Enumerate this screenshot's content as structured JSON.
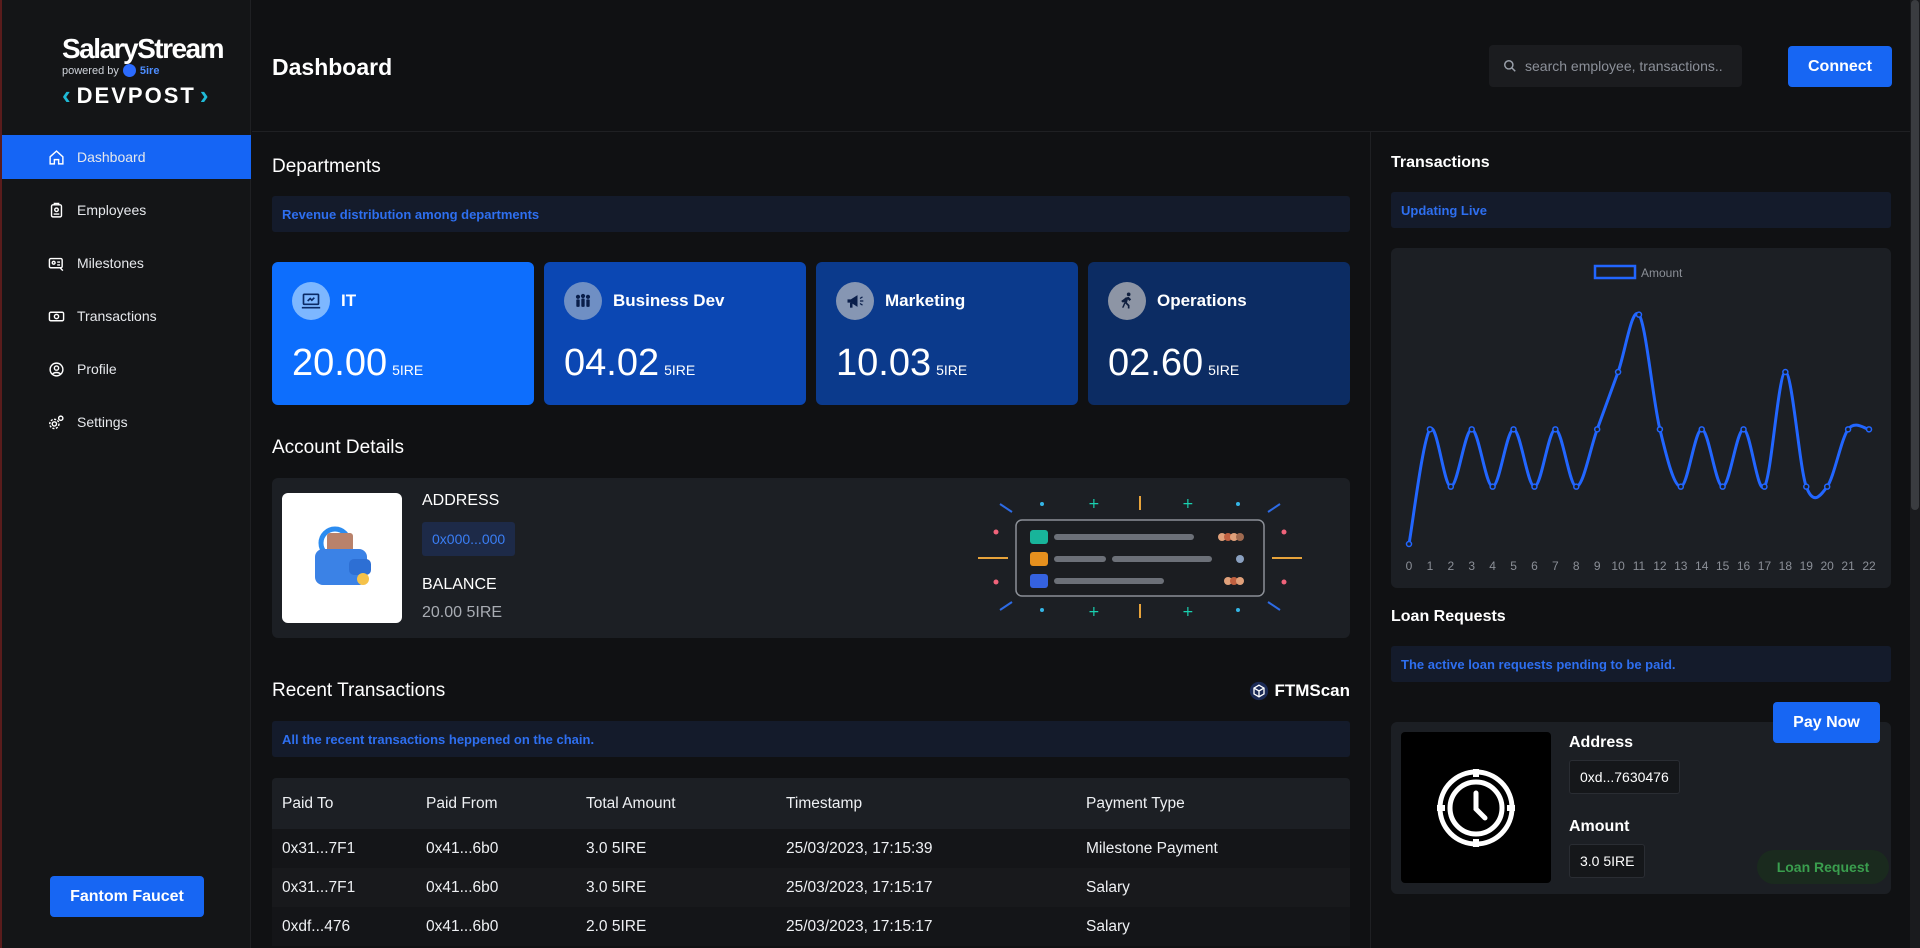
{
  "brand": {
    "title": "SalaryStream",
    "powered": "powered by",
    "powered_brand": "5ire",
    "devpost": "DEVPOST"
  },
  "sidebar": {
    "items": [
      {
        "label": "Dashboard",
        "icon": "home-icon",
        "active": true
      },
      {
        "label": "Employees",
        "icon": "badge-icon"
      },
      {
        "label": "Milestones",
        "icon": "card-icon"
      },
      {
        "label": "Transactions",
        "icon": "money-icon"
      },
      {
        "label": "Profile",
        "icon": "user-icon"
      },
      {
        "label": "Settings",
        "icon": "gear-icon"
      }
    ],
    "faucet_label": "Fantom Faucet"
  },
  "header": {
    "title": "Dashboard",
    "search_placeholder": "search employee, transactions..",
    "connect_label": "Connect"
  },
  "departments": {
    "title": "Departments",
    "subtitle": "Revenue distribution among departments",
    "cards": [
      {
        "name": "IT",
        "value": "20.00",
        "unit": "5IRE",
        "bg": "#0d6efd",
        "icon_bg": "#7db7ff",
        "icon": "laptop-icon"
      },
      {
        "name": "Business Dev",
        "value": "04.02",
        "unit": "5IRE",
        "bg": "#0b47b3",
        "icon_bg": "#6f8fc4",
        "icon": "team-icon"
      },
      {
        "name": "Marketing",
        "value": "10.03",
        "unit": "5IRE",
        "bg": "#0b3a8c",
        "icon_bg": "#8696b3",
        "icon": "megaphone-icon"
      },
      {
        "name": "Operations",
        "value": "02.60",
        "unit": "5IRE",
        "bg": "#0c2c63",
        "icon_bg": "#8d95a5",
        "icon": "runner-icon"
      }
    ]
  },
  "account": {
    "title": "Account Details",
    "address_label": "ADDRESS",
    "address_value": "0x000...000",
    "balance_label": "BALANCE",
    "balance_value": "20.00 5IRE"
  },
  "recent": {
    "title": "Recent Transactions",
    "subtitle": "All the recent transactions heppened on the chain.",
    "ftmscan_label": "FTMScan",
    "columns": [
      "Paid To",
      "Paid From",
      "Total Amount",
      "Timestamp",
      "Payment Type"
    ],
    "rows": [
      [
        "0x31...7F1",
        "0x41...6b0",
        "3.0 5IRE",
        "25/03/2023, 17:15:39",
        "Milestone Payment"
      ],
      [
        "0x31...7F1",
        "0x41...6b0",
        "3.0 5IRE",
        "25/03/2023, 17:15:17",
        "Salary"
      ],
      [
        "0xdf...476",
        "0x41...6b0",
        "2.0 5IRE",
        "25/03/2023, 17:15:17",
        "Salary"
      ]
    ]
  },
  "transactions_panel": {
    "title": "Transactions",
    "subtitle": "Updating Live"
  },
  "chart_data": {
    "type": "line",
    "series": [
      {
        "name": "Amount",
        "values": [
          0,
          2,
          1,
          2,
          1,
          2,
          1,
          2,
          1,
          2,
          3,
          4,
          2,
          1,
          2,
          1,
          2,
          1,
          3,
          1,
          1,
          2,
          2
        ]
      }
    ],
    "x": [
      0,
      1,
      2,
      3,
      4,
      5,
      6,
      7,
      8,
      9,
      10,
      11,
      12,
      13,
      14,
      15,
      16,
      17,
      18,
      19,
      20,
      21,
      22
    ],
    "color": "#2266ff",
    "legend": "top-center",
    "ylim": [
      0,
      4.5
    ]
  },
  "loans": {
    "title": "Loan Requests",
    "subtitle": "The active loan requests pending to be paid.",
    "pay_label": "Pay Now",
    "address_label": "Address",
    "address_value": "0xd...7630476",
    "amount_label": "Amount",
    "amount_value": "3.0 5IRE",
    "badge": "Loan Request"
  }
}
